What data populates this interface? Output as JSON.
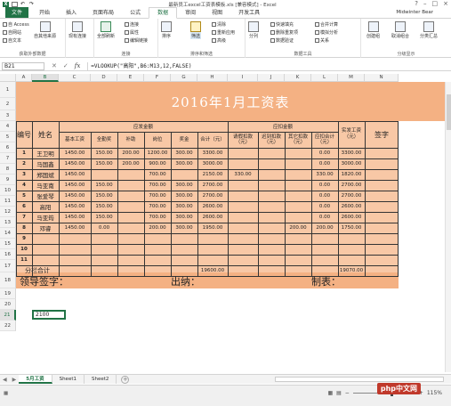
{
  "titlebar": {
    "title": "最新员工excel工资表模板.xls [兼容模式] - Excel"
  },
  "tabs": [
    "文件",
    "开始",
    "插入",
    "页面布局",
    "公式",
    "数据",
    "审阅",
    "视图",
    "开发工具"
  ],
  "active_tab": "数据",
  "user": "Midwinter Bear",
  "ribbon": {
    "get_external": {
      "label": "获取外部数据",
      "items": [
        "自 Access",
        "自网站",
        "自文本",
        "自其他来源"
      ]
    },
    "existing": "现有连接",
    "refresh": "全部刷新",
    "connections": {
      "label": "连接",
      "items": [
        "连接",
        "属性",
        "编辑链接"
      ]
    },
    "sort": {
      "label": "排序和筛选",
      "items": [
        "排序",
        "筛选",
        "清除",
        "重新应用",
        "高级"
      ]
    },
    "tools": {
      "label": "数据工具",
      "items": [
        "分列",
        "快速填充",
        "删除重复项",
        "数据验证",
        "合并计算",
        "模拟分析",
        "关系"
      ]
    },
    "outline": {
      "label": "分级显示",
      "items": [
        "创建组",
        "取消组合",
        "分类汇总"
      ]
    }
  },
  "formula_bar": {
    "name_box": "B21",
    "formula": "=VLOOKUP(\"高阳\",B6:M13,12,FALSE)"
  },
  "columns": [
    "A",
    "B",
    "C",
    "D",
    "E",
    "F",
    "G",
    "H",
    "I",
    "J",
    "K",
    "L",
    "M",
    "N"
  ],
  "rows": [
    "1",
    "2",
    "3",
    "4",
    "5",
    "6",
    "7",
    "8",
    "9",
    "10",
    "11",
    "12",
    "13",
    "14",
    "15",
    "16",
    "17",
    "18",
    "19",
    "20",
    "21",
    "22"
  ],
  "sheet": {
    "title": "2016年1月工资表",
    "hdr_no": "编号",
    "hdr_name": "姓名",
    "hdr_payable": "应发金额",
    "hdr_deduct": "应扣金额",
    "hdr_actual": "实发工资（元）",
    "hdr_sign": "签字",
    "sub": [
      "基本工资",
      "全勤奖",
      "补助",
      "岗位",
      "奖金",
      "合计（元）",
      "请假扣款（元）",
      "迟到扣款（元）",
      "其它扣款（元）",
      "应扣合计（元）"
    ],
    "rows": [
      {
        "no": "1",
        "name": "王卫明",
        "base": "1450.00",
        "attend": "150.00",
        "sub": "200.00",
        "post": "1200.00",
        "bonus": "300.00",
        "total": "3300.00",
        "leave": "",
        "late": "",
        "other": "",
        "ded": "0.00",
        "actual": "3300.00"
      },
      {
        "no": "2",
        "name": "马国鑫",
        "base": "1450.00",
        "attend": "150.00",
        "sub": "200.00",
        "post": "900.00",
        "bonus": "300.00",
        "total": "3000.00",
        "leave": "",
        "late": "",
        "other": "",
        "ded": "0.00",
        "actual": "3000.00"
      },
      {
        "no": "3",
        "name": "郑国斌",
        "base": "1450.00",
        "attend": "",
        "sub": "",
        "post": "700.00",
        "bonus": "",
        "total": "2150.00",
        "leave": "330.00",
        "late": "",
        "other": "",
        "ded": "330.00",
        "actual": "1820.00"
      },
      {
        "no": "4",
        "name": "马亚南",
        "base": "1450.00",
        "attend": "150.00",
        "sub": "",
        "post": "700.00",
        "bonus": "300.00",
        "total": "2700.00",
        "leave": "",
        "late": "",
        "other": "",
        "ded": "0.00",
        "actual": "2700.00"
      },
      {
        "no": "5",
        "name": "张爱琴",
        "base": "1450.00",
        "attend": "150.00",
        "sub": "",
        "post": "700.00",
        "bonus": "300.00",
        "total": "2700.00",
        "leave": "",
        "late": "",
        "other": "",
        "ded": "0.00",
        "actual": "2700.00"
      },
      {
        "no": "6",
        "name": "高阳",
        "base": "1450.00",
        "attend": "150.00",
        "sub": "",
        "post": "700.00",
        "bonus": "300.00",
        "total": "2600.00",
        "leave": "",
        "late": "",
        "other": "",
        "ded": "0.00",
        "actual": "2600.00"
      },
      {
        "no": "7",
        "name": "马亚筠",
        "base": "1450.00",
        "attend": "150.00",
        "sub": "",
        "post": "700.00",
        "bonus": "300.00",
        "total": "2600.00",
        "leave": "",
        "late": "",
        "other": "",
        "ded": "0.00",
        "actual": "2600.00"
      },
      {
        "no": "8",
        "name": "邓睿",
        "base": "1450.00",
        "attend": "0.00",
        "sub": "",
        "post": "200.00",
        "bonus": "300.00",
        "total": "1950.00",
        "leave": "",
        "late": "",
        "other": "200.00",
        "ded": "200.00",
        "actual": "1750.00"
      },
      {
        "no": "9",
        "name": "",
        "base": "",
        "attend": "",
        "sub": "",
        "post": "",
        "bonus": "",
        "total": "",
        "leave": "",
        "late": "",
        "other": "",
        "ded": "",
        "actual": ""
      },
      {
        "no": "10",
        "name": "",
        "base": "",
        "attend": "",
        "sub": "",
        "post": "",
        "bonus": "",
        "total": "",
        "leave": "",
        "late": "",
        "other": "",
        "ded": "",
        "actual": ""
      },
      {
        "no": "11",
        "name": "",
        "base": "",
        "attend": "",
        "sub": "",
        "post": "",
        "bonus": "",
        "total": "",
        "leave": "",
        "late": "",
        "other": "",
        "ded": "",
        "actual": ""
      }
    ],
    "subtotal_label": "分栏合计",
    "subtotal_total": "19600.00",
    "subtotal_actual": "19070.00",
    "footer_leader": "领导签字：",
    "footer_cashier": "出纳：",
    "footer_maker": "制表：",
    "active_value": "2100"
  },
  "sheet_tabs": [
    "5月工资",
    "Sheet1",
    "Sheet2"
  ],
  "active_sheet": "5月工资",
  "status": {
    "zoom": "115%"
  },
  "watermark": "php中文网"
}
